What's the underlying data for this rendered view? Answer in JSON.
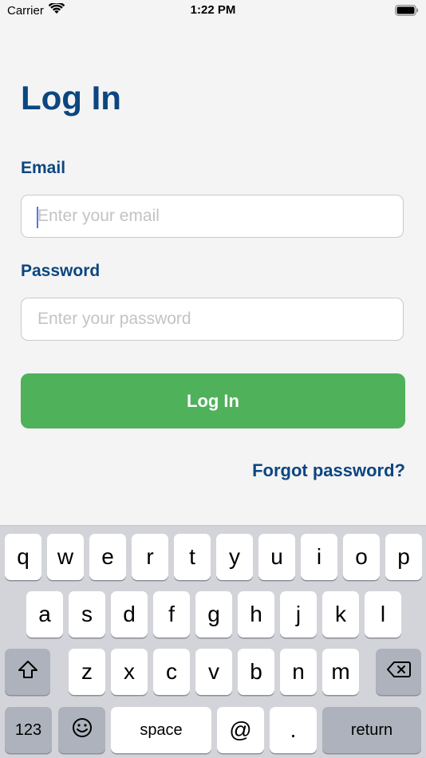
{
  "status_bar": {
    "carrier": "Carrier",
    "time": "1:22 PM"
  },
  "page": {
    "title": "Log In"
  },
  "form": {
    "email_label": "Email",
    "email_placeholder": "Enter your email",
    "password_label": "Password",
    "password_placeholder": "Enter your password",
    "submit_label": "Log In",
    "forgot_label": "Forgot password?"
  },
  "colors": {
    "title": "#0b4680",
    "button": "#4fb15a",
    "background": "#f4f4f4"
  },
  "keyboard": {
    "row1": [
      "q",
      "w",
      "e",
      "r",
      "t",
      "y",
      "u",
      "i",
      "o",
      "p"
    ],
    "row2": [
      "a",
      "s",
      "d",
      "f",
      "g",
      "h",
      "j",
      "k",
      "l"
    ],
    "row3": [
      "z",
      "x",
      "c",
      "v",
      "b",
      "n",
      "m"
    ],
    "numbers_label": "123",
    "space_label": "space",
    "at_label": "@",
    "dot_label": ".",
    "return_label": "return",
    "shift_icon": "shift-icon",
    "delete_icon": "delete-icon",
    "emoji_icon": "emoji-icon"
  }
}
